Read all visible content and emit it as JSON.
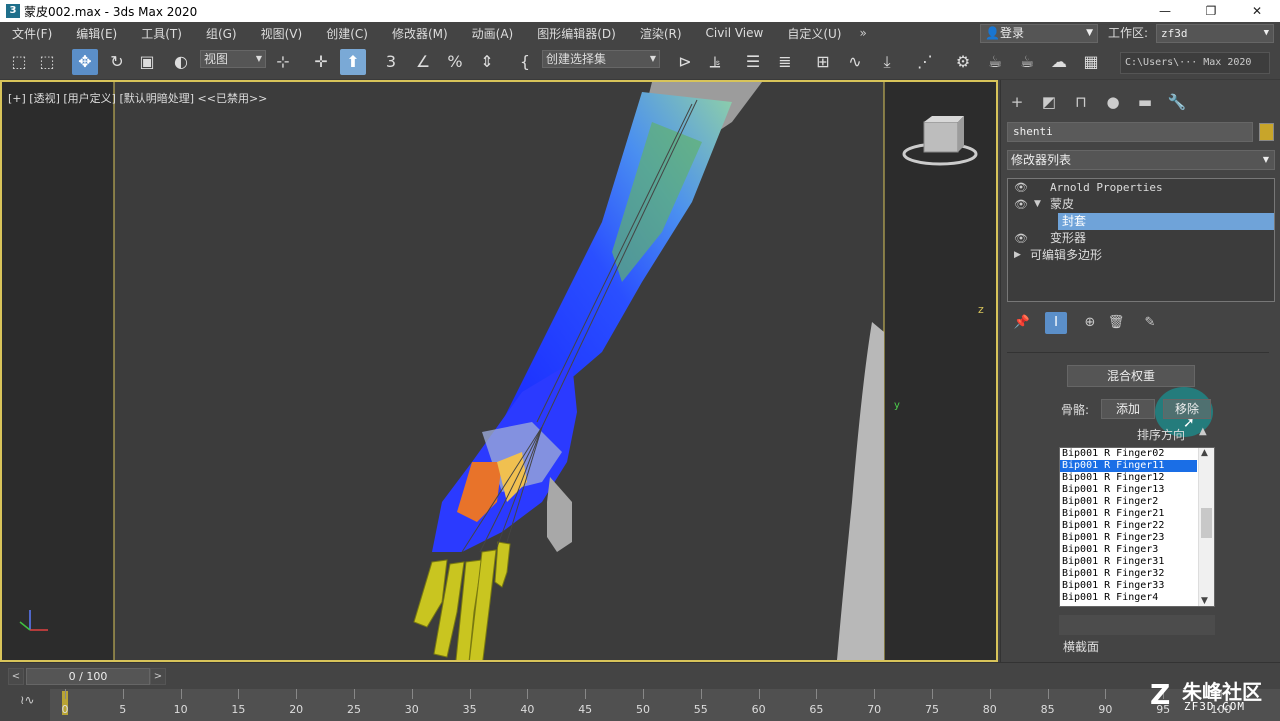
{
  "titlebar": {
    "app_icon": "3",
    "title": "蒙皮002.max - 3ds Max 2020",
    "minimize": "—",
    "restore": "❐",
    "close": "✕"
  },
  "menu": {
    "items": [
      "文件(F)",
      "编辑(E)",
      "工具(T)",
      "组(G)",
      "视图(V)",
      "创建(C)",
      "修改器(M)",
      "动画(A)",
      "图形编辑器(D)",
      "渲染(R)",
      "Civil View",
      "自定义(U)"
    ],
    "more": "»",
    "login": "登录",
    "workspace_label": "工作区:",
    "workspace_value": "zf3d"
  },
  "toolbar": {
    "view_dropdown": "视图",
    "selection_set": "创建选择集",
    "project_path": "C:\\Users\\··· Max 2020"
  },
  "viewport": {
    "label": "[+] [透视] [用户定义] [默认明暗处理] <<已禁用>>",
    "axis_z": "z",
    "axis_y": "y"
  },
  "command_panel": {
    "object_name": "shenti",
    "object_color": "#c8a52a",
    "modifier_list": "修改器列表",
    "stack": [
      {
        "label": "Arnold Properties",
        "eye": true,
        "arrow": ""
      },
      {
        "label": "蒙皮",
        "eye": true,
        "arrow": "▼"
      },
      {
        "label": "封套",
        "eye": false,
        "arrow": ""
      },
      {
        "label": "变形器",
        "eye": true,
        "arrow": ""
      },
      {
        "label": "可编辑多边形",
        "eye": false,
        "arrow": "▶"
      }
    ],
    "blend_weights_button": "混合权重",
    "bones_label": "骨骼:",
    "add_button": "添加",
    "remove_button": "移除",
    "sort_label": "排序方向",
    "bones": [
      "Bip001 R Finger02",
      "Bip001 R Finger11",
      "Bip001 R Finger12",
      "Bip001 R Finger13",
      "Bip001 R Finger2",
      "Bip001 R Finger21",
      "Bip001 R Finger22",
      "Bip001 R Finger23",
      "Bip001 R Finger3",
      "Bip001 R Finger31",
      "Bip001 R Finger32",
      "Bip001 R Finger33",
      "Bip001 R Finger4"
    ],
    "selected_bone_index": 1,
    "cross_section_label": "横截面"
  },
  "timeline": {
    "frame_display": "0 / 100",
    "ticks": [
      "0",
      "5",
      "10",
      "15",
      "20",
      "25",
      "30",
      "35",
      "40",
      "45",
      "50",
      "55",
      "60",
      "65",
      "70",
      "75",
      "80",
      "85",
      "90",
      "95",
      "100"
    ]
  },
  "watermark": {
    "text": "朱峰社区",
    "url": "ZF3D.COM"
  }
}
